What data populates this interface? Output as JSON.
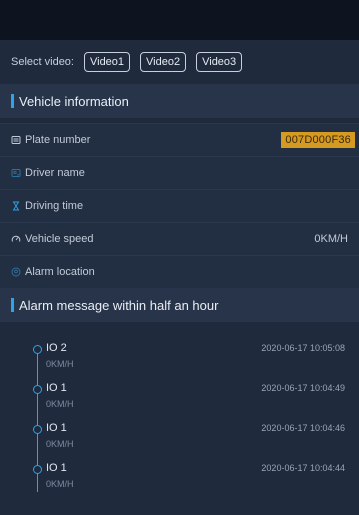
{
  "video_selector": {
    "label": "Select video:",
    "buttons": [
      "Video1",
      "Video2",
      "Video3"
    ]
  },
  "vehicle_section": {
    "title": "Vehicle information"
  },
  "vehicle_info": [
    {
      "label": "Plate number",
      "value": "007D000F36",
      "icon": "plate-icon"
    },
    {
      "label": "Driver name",
      "value": "",
      "icon": "driver-icon"
    },
    {
      "label": "Driving time",
      "value": "",
      "icon": "hourglass-icon"
    },
    {
      "label": "Vehicle speed",
      "value": "0KM/H",
      "icon": "speedometer-icon"
    },
    {
      "label": "Alarm location",
      "value": "",
      "icon": "location-pin-icon"
    }
  ],
  "alarm_section": {
    "title": "Alarm message within half an hour"
  },
  "alarms": [
    {
      "title": "IO 2",
      "speed": "0KM/H",
      "time": "2020-06-17 10:05:08"
    },
    {
      "title": "IO 1",
      "speed": "0KM/H",
      "time": "2020-06-17 10:04:49"
    },
    {
      "title": "IO 1",
      "speed": "0KM/H",
      "time": "2020-06-17 10:04:46"
    },
    {
      "title": "IO 1",
      "speed": "0KM/H",
      "time": "2020-06-17 10:04:44"
    }
  ],
  "colors": {
    "accent": "#2fa3e8",
    "plate_badge": "#d59a22",
    "background": "#1f2a3d"
  }
}
